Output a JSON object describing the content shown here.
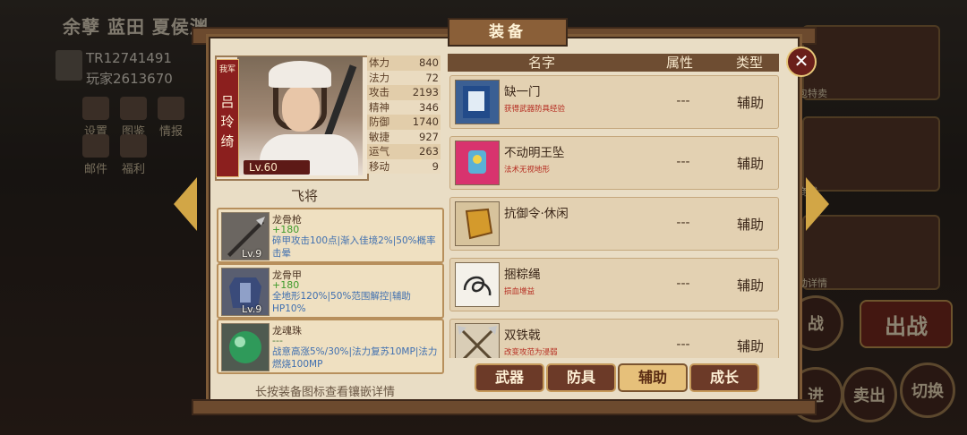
{
  "background": {
    "team_title": "余孽 蓝田 夏侯渊",
    "player_id": "TR12741491",
    "player_name": "玩家2613670",
    "menu": [
      "设置",
      "图鉴",
      "情报",
      "邮件",
      "福利"
    ],
    "right_labels": [
      "礼包特卖",
      "家商城",
      "活动详情"
    ],
    "buttons": [
      "战",
      "出战",
      "进",
      "卖出",
      "切换"
    ]
  },
  "dialog": {
    "title": "装备",
    "close_icon": "close-icon"
  },
  "general": {
    "country": "我军",
    "name": "吕玲绮",
    "level": "Lv.60",
    "unit_type": "飞将",
    "stats": [
      {
        "name": "体力",
        "value": "840"
      },
      {
        "name": "法力",
        "value": "72"
      },
      {
        "name": "攻击",
        "value": "2193"
      },
      {
        "name": "精神",
        "value": "346"
      },
      {
        "name": "防御",
        "value": "1740"
      },
      {
        "name": "敏捷",
        "value": "927"
      },
      {
        "name": "运气",
        "value": "263"
      },
      {
        "name": "移动",
        "value": "9"
      }
    ]
  },
  "equipped": [
    {
      "name": "龙骨枪",
      "bonus": "+180",
      "desc": "碎甲攻击100点|渐入佳境2%|50%概率击晕",
      "level": "Lv.9",
      "icon": "spear-icon"
    },
    {
      "name": "龙骨甲",
      "bonus": "+180",
      "desc": "全地形120%|50%范围解控|辅助HP10%",
      "level": "Lv.9",
      "icon": "armor-icon"
    },
    {
      "name": "龙魂珠",
      "bonus": "---",
      "desc": "战意高涨5%/30%|法力复苏10MP|法力燃烧100MP",
      "level": "",
      "icon": "orb-icon"
    }
  ],
  "hint": "长按装备图标查看镶嵌详情",
  "table": {
    "headers": {
      "name": "名字",
      "attr": "属性",
      "type": "类型"
    }
  },
  "items": [
    {
      "name": "缺一门",
      "desc": "获得武器防具经验",
      "attr": "---",
      "type": "辅助",
      "icon": "book-icon"
    },
    {
      "name": "不动明王坠",
      "desc": "法术无视地形",
      "attr": "---",
      "type": "辅助",
      "icon": "pendant-icon"
    },
    {
      "name": "抗御令·休闲",
      "desc": "",
      "attr": "---",
      "type": "辅助",
      "icon": "token-icon"
    },
    {
      "name": "捆粽绳",
      "desc": "损血增益",
      "attr": "---",
      "type": "辅助",
      "icon": "rope-icon"
    },
    {
      "name": "双铁戟",
      "desc": "改变攻范为浸弱",
      "attr": "---",
      "type": "辅助",
      "icon": "crossed-halberds-icon"
    }
  ],
  "tabs": [
    {
      "label": "武器",
      "active": false
    },
    {
      "label": "防具",
      "active": false
    },
    {
      "label": "辅助",
      "active": true
    },
    {
      "label": "成长",
      "active": false
    }
  ],
  "colors": {
    "panel": "#e9ddc5",
    "header": "#6e4d32",
    "accent_gold": "#d2a646",
    "bonus_green": "#3e9a2b",
    "desc_blue": "#3f6fb0",
    "desc_red": "#b52a1f"
  }
}
